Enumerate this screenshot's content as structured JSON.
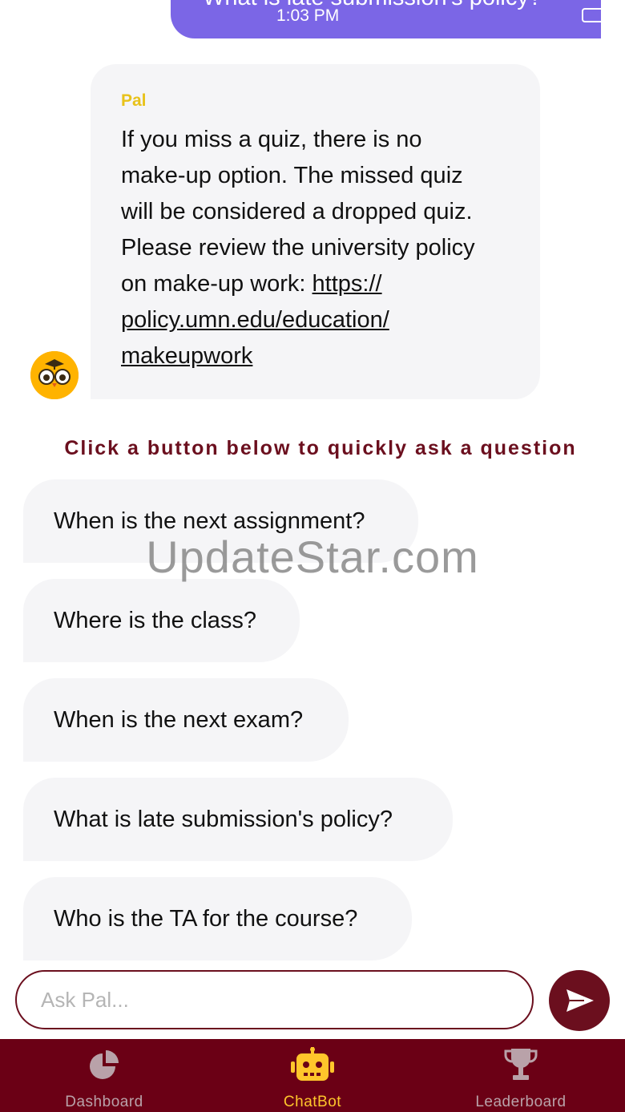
{
  "user_message": {
    "text": "What is late submission's policy?",
    "time": "1:03 PM"
  },
  "bot_message": {
    "sender": "Pal",
    "text_lines": [
      "If you miss a quiz, there is no",
      "make-up option.  The missed quiz",
      "will be considered a dropped quiz.",
      "Please review the university policy",
      "on make-up work: "
    ],
    "link_lines": [
      "https://",
      "policy.umn.edu/education/",
      "makeupwork"
    ]
  },
  "quick_prompt": "Click a button below to quickly ask a question",
  "quick_buttons": [
    "When is the next assignment?",
    "Where is the class?",
    "When is the next exam?",
    "What is late submission's policy?",
    "Who is the TA for the course?"
  ],
  "watermark": "UpdateStar.com",
  "input": {
    "placeholder": "Ask Pal..."
  },
  "tabs": [
    {
      "label": "Dashboard",
      "icon": "pie-chart-icon",
      "active": false
    },
    {
      "label": "ChatBot",
      "icon": "robot-icon",
      "active": true
    },
    {
      "label": "Leaderboard",
      "icon": "trophy-icon",
      "active": false
    }
  ],
  "colors": {
    "user_bubble": "#7b66e6",
    "bot_bubble": "#f5f5f7",
    "brand_maroon": "#6b0015",
    "accent_gold": "#ffc62b",
    "bot_name": "#e8c21a"
  }
}
